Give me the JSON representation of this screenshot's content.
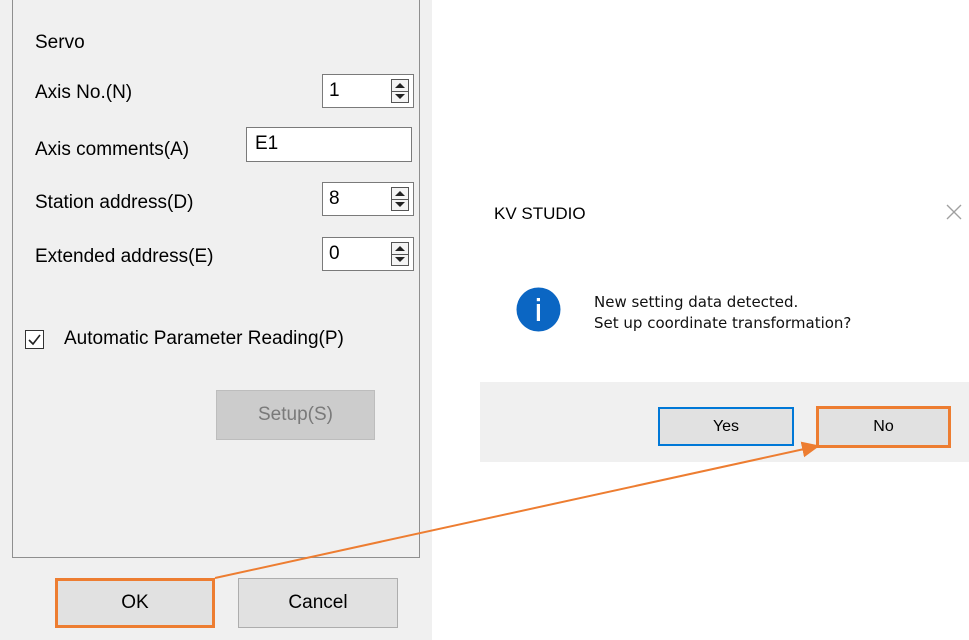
{
  "servo_panel": {
    "group_title": "Servo",
    "axis_no": {
      "label": "Axis No.(N)",
      "value": "1"
    },
    "axis_comments": {
      "label": "Axis comments(A)",
      "value": "E1"
    },
    "station_address": {
      "label": "Station address(D)",
      "value": "8"
    },
    "extended_address": {
      "label": "Extended address(E)",
      "value": "0"
    },
    "auto_param": {
      "label": "Automatic Parameter Reading(P)",
      "checked": true
    },
    "setup_label": "Setup(S)",
    "ok_label": "OK",
    "cancel_label": "Cancel"
  },
  "message_box": {
    "title": "KV STUDIO",
    "line1": "New setting data detected.",
    "line2": "Set up coordinate transformation?",
    "yes_label": "Yes",
    "no_label": "No",
    "icon": "info-icon"
  },
  "annotation": {
    "highlight_color": "#ED7D31",
    "arrow": "from OK button to No button"
  }
}
